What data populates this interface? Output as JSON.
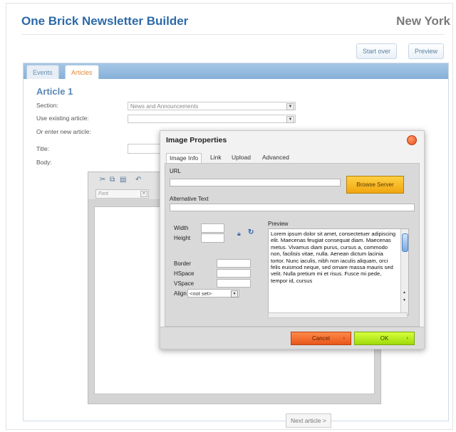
{
  "header": {
    "app_title": "One Brick Newsletter Builder",
    "city": "New York"
  },
  "top_buttons": {
    "start_over": "Start over",
    "preview": "Preview"
  },
  "tabs": [
    {
      "label": "Events"
    },
    {
      "label": "Articles"
    }
  ],
  "article": {
    "title": "Article 1",
    "section_label": "Section:",
    "section_value": "News and Announcements",
    "existing_label": "Use existing article:",
    "existing_value": "",
    "enter_new_label": "Or enter new article:",
    "title_label": "Title:",
    "body_label": "Body:"
  },
  "editor": {
    "font_placeholder": "Font",
    "tool_icons": [
      "cut-icon",
      "copy-icon",
      "paste-icon",
      "undo-icon"
    ]
  },
  "next_button": "Next article >",
  "dialog": {
    "title": "Image Properties",
    "tabs": [
      "Image Info",
      "Link",
      "Upload",
      "Advanced"
    ],
    "url_label": "URL",
    "browse_label": "Browse Server",
    "alt_label": "Alternative Text",
    "width_label": "Width",
    "height_label": "Height",
    "border_label": "Border",
    "hspace_label": "HSpace",
    "vspace_label": "VSpace",
    "align_label": "Align",
    "align_value": "<not set>",
    "preview_label": "Preview",
    "preview_text": "Lorem ipsum dolor sit amet, consectetuer adipiscing elit. Maecenas feugiat consequat diam. Maecenas metus. Vivamus diam purus, cursus a, commodo non, facilisis vitae, nulla. Aenean dictum lacinia tortor. Nunc iaculis, nibh non iaculis aliquam, orci felis euismod neque, sed ornare massa mauris sed velit. Nulla pretium mi et risus. Fusce mi pede, tempor id, cursus",
    "cancel_label": "Cancel",
    "ok_label": "OK"
  },
  "colors": {
    "title_blue": "#2d6aa8",
    "cancel_orange": "#e8561a",
    "ok_green": "#9fdb0a",
    "browse_gold": "#f0a60f",
    "close_red": "#e24d1a"
  }
}
